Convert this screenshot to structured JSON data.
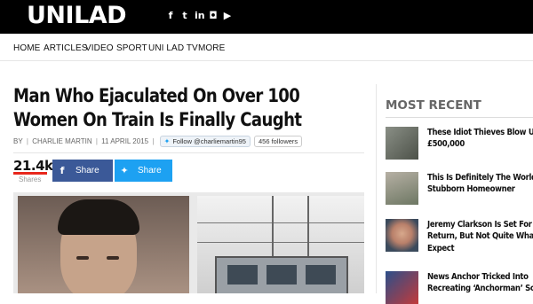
{
  "header": {
    "logo": "UNILAD",
    "social_icons": [
      {
        "icon": "facebook-icon",
        "glyph": "f"
      },
      {
        "icon": "twitter-icon",
        "glyph": "t"
      },
      {
        "icon": "linkedin-icon",
        "glyph": "in"
      },
      {
        "icon": "instagram-icon",
        "glyph": "◘"
      },
      {
        "icon": "youtube-icon",
        "glyph": "▶"
      }
    ]
  },
  "nav": {
    "items": [
      "HOME",
      "ARTICLES",
      "VIDEO",
      "SPORT",
      "UNI LAD TV",
      "MORE"
    ]
  },
  "article": {
    "headline": "Man Who Ejaculated On Over 100 Women On Train Is Finally Caught",
    "by_label": "BY",
    "author": "CHARLIE MARTIN",
    "date": "11 APRIL 2015",
    "follow_button": "Follow @charliemartin95",
    "followers": "456 followers",
    "share_count": "21.4k",
    "shares_label": "Shares",
    "facebook_share": "Share",
    "twitter_share": "Share"
  },
  "sidebar": {
    "title": "MOST RECENT",
    "stories": [
      {
        "line1": "These Idiot Thieves Blow Up",
        "line2": "£500,000",
        "line3": ""
      },
      {
        "line1": "This Is Definitely The World’s M",
        "line2": "Stubborn Homeowner",
        "line3": ""
      },
      {
        "line1": "Jeremy Clarkson Is Set For A TV",
        "line2": "Return, But Not Quite What You",
        "line3": "Expect"
      },
      {
        "line1": "News Anchor Tricked Into",
        "line2": "Recreating ‘Anchorman’ Scene",
        "line3": ""
      }
    ]
  },
  "colors": {
    "topbar": "#000000",
    "facebook": "#3b5998",
    "twitter": "#1da1f2",
    "accent_red": "#e8271c"
  }
}
